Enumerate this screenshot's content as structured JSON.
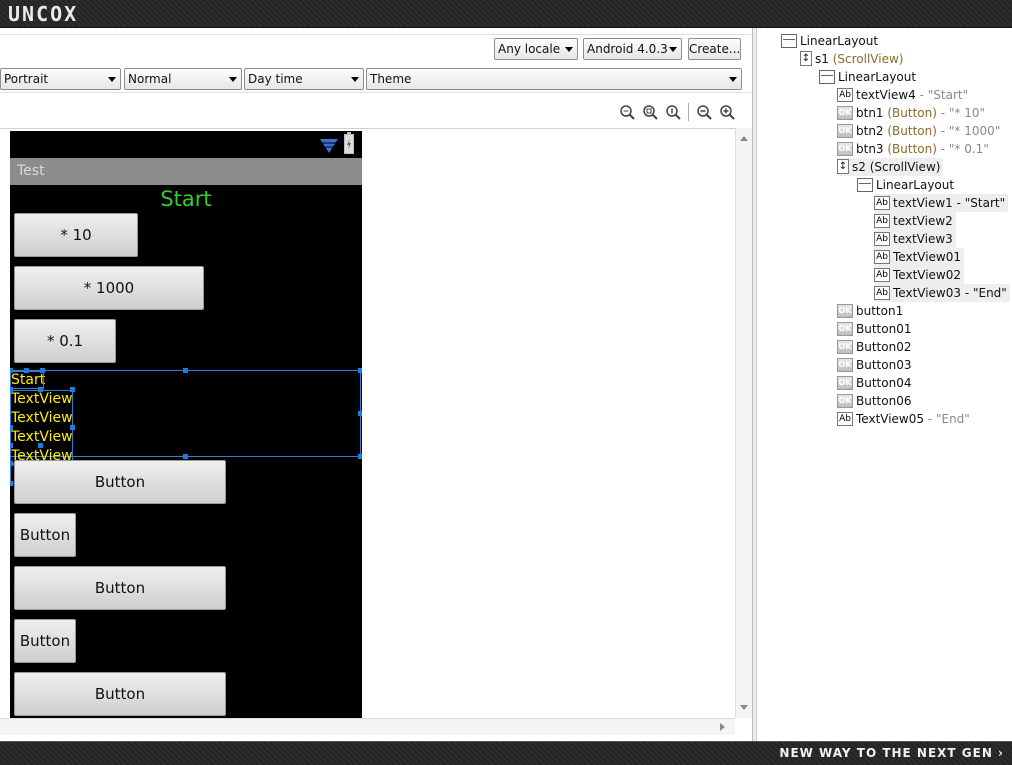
{
  "banner": {
    "logo": "UNCOX",
    "tagline": "New way to the next gen ›"
  },
  "toolbar": {
    "locale": "Any locale",
    "android_version": "Android 4.0.3",
    "create_label": "Create...",
    "orientation": "Portrait",
    "mode": "Normal",
    "daytime": "Day time",
    "theme": "Theme"
  },
  "zoom_icons": [
    "zoom-fit-icon",
    "zoom-real-icon",
    "zoom-100-icon",
    "zoom-out-icon",
    "zoom-in-icon"
  ],
  "preview": {
    "app_title": "Test",
    "start_text": "Start",
    "btn1": "* 10",
    "btn2": "* 1000",
    "btn3": "* 0.1",
    "scroll_texts": [
      "Start",
      "TextView",
      "TextView",
      "TextView",
      "TextView"
    ],
    "buttons": [
      "Button",
      "Button",
      "Button",
      "Button",
      "Button"
    ]
  },
  "outline": {
    "nodes": [
      {
        "name": "LinearLayout",
        "type": "",
        "text": "",
        "icon": "layout-icon"
      },
      {
        "name": "s1",
        "type": "(ScrollView)",
        "text": "",
        "icon": "scrollview-icon"
      },
      {
        "name": "LinearLayout",
        "type": "",
        "text": "",
        "icon": "layout-icon"
      },
      {
        "name": "textView4",
        "type": "",
        "text": " - \"Start\"",
        "icon": "textview-icon"
      },
      {
        "name": "btn1",
        "type": " (Button)",
        "text": " - \"* 10\"",
        "icon": "button-icon"
      },
      {
        "name": "btn2",
        "type": " (Button)",
        "text": " - \"* 1000\"",
        "icon": "button-icon"
      },
      {
        "name": "btn3",
        "type": " (Button)",
        "text": " - \"* 0.1\"",
        "icon": "button-icon"
      },
      {
        "name": "s2 (ScrollView)",
        "type": "",
        "text": "",
        "icon": "scrollview-icon"
      },
      {
        "name": "LinearLayout",
        "type": "",
        "text": "",
        "icon": "layout-icon"
      },
      {
        "name": "textView1 - \"Start\"",
        "type": "",
        "text": "",
        "icon": "textview-icon"
      },
      {
        "name": "textView2",
        "type": "",
        "text": "",
        "icon": "textview-icon"
      },
      {
        "name": "textView3",
        "type": "",
        "text": "",
        "icon": "textview-icon"
      },
      {
        "name": "TextView01",
        "type": "",
        "text": "",
        "icon": "textview-icon"
      },
      {
        "name": "TextView02",
        "type": "",
        "text": "",
        "icon": "textview-icon"
      },
      {
        "name": "TextView03 - \"End\"",
        "type": "",
        "text": "",
        "icon": "textview-icon"
      },
      {
        "name": "button1",
        "type": "",
        "text": "",
        "icon": "button-icon"
      },
      {
        "name": "Button01",
        "type": "",
        "text": "",
        "icon": "button-icon"
      },
      {
        "name": "Button02",
        "type": "",
        "text": "",
        "icon": "button-icon"
      },
      {
        "name": "Button03",
        "type": "",
        "text": "",
        "icon": "button-icon"
      },
      {
        "name": "Button04",
        "type": "",
        "text": "",
        "icon": "button-icon"
      },
      {
        "name": "Button06",
        "type": "",
        "text": "",
        "icon": "button-icon"
      },
      {
        "name": "TextView05",
        "type": "",
        "text": " - \"End\"",
        "icon": "textview-icon"
      }
    ]
  }
}
